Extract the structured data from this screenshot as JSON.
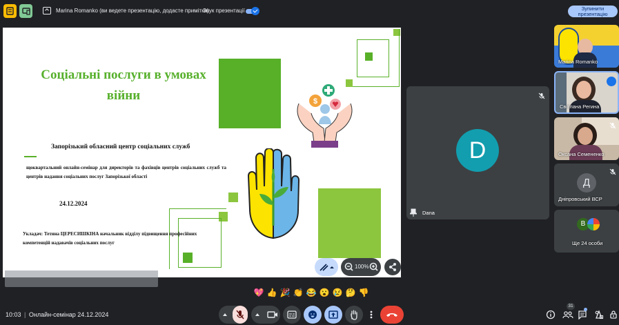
{
  "topbar": {
    "presenting_text": "Marina Romanko (ви ведете презентацію, додасте примітки)",
    "sound_label": "Звук презентації",
    "stop_button": "Зупинити\nпрезентацію"
  },
  "slide": {
    "title": "Соціальні послуги в умовах війни",
    "organization": "Запорізький обласний центр соціальних служб",
    "seminar": "щоквартальний онлайн-семінар для директорів та фахівців центрів соціальних служб та центрів надання соціальних послуг Запорізької області",
    "date": "24.12.2024",
    "author": "Укладач: Тетяна ЦЕРЕСИШКІНА начальник відділу підвищення професійних компетенцій надавачів соціальних послуг"
  },
  "zoom": {
    "value": "100%"
  },
  "center_tile": {
    "avatar_letter": "D",
    "name": "Dana"
  },
  "participants": [
    {
      "name": "Marina Romanko"
    },
    {
      "name": "Світлана Регина"
    },
    {
      "name": "Оксана Семененко"
    },
    {
      "name": "Дніпровський ВСР",
      "avatar": "Д"
    },
    {
      "name": "Ще 24 особи",
      "avatar": "В"
    }
  ],
  "reactions": [
    "💖",
    "👍",
    "🎉",
    "👏",
    "😂",
    "😮",
    "😢",
    "🤔",
    "👎"
  ],
  "bottombar": {
    "time": "10:03",
    "meeting_title": "Онлайн-семінар 24.12.2024",
    "people_count": "31"
  },
  "colors": {
    "accent_green": "#58b028",
    "title_green": "#57b02c",
    "hangup_red": "#ea4335",
    "avatar_teal": "#129eaf"
  }
}
